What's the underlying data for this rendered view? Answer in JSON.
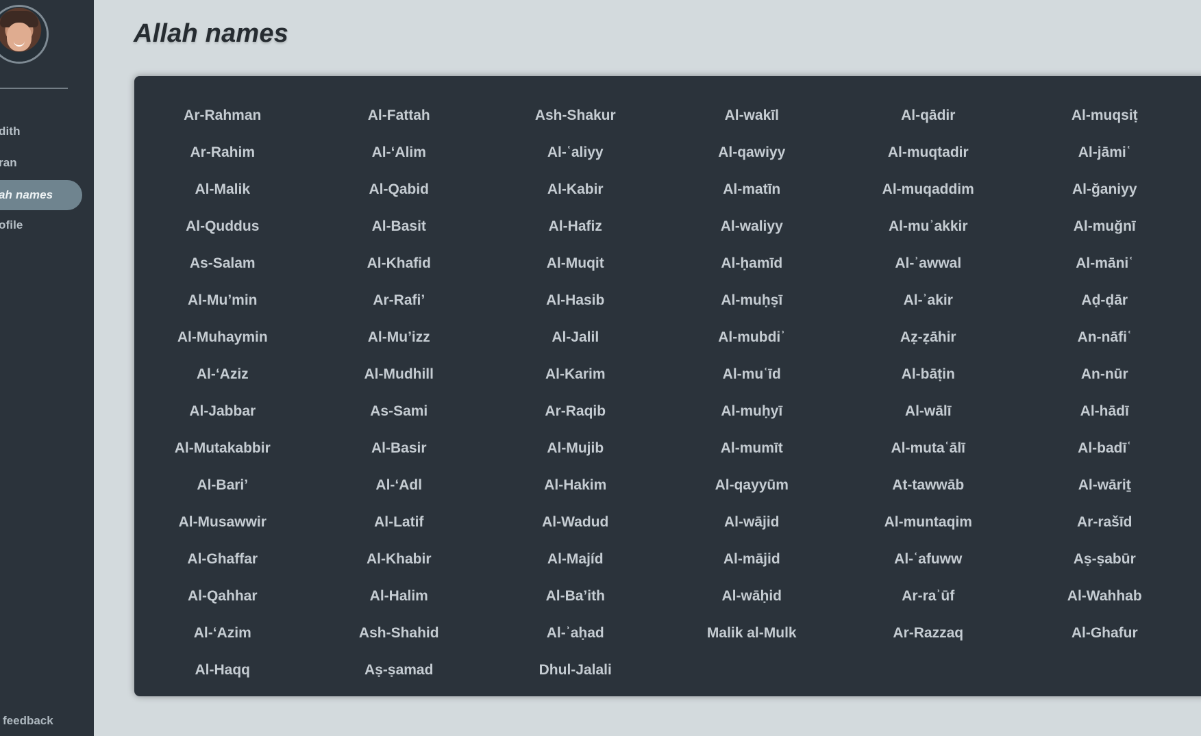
{
  "app": {
    "page_title": "Allah names"
  },
  "sidebar": {
    "avatar": "avatar",
    "items": [
      {
        "label": "dith",
        "active": false
      },
      {
        "label": "ran",
        "active": false
      },
      {
        "label": "ah names",
        "active": true
      },
      {
        "label": "ofile",
        "active": false
      }
    ],
    "feedback_label": "feedback"
  },
  "main": {
    "names": [
      [
        "Ar-Rahman",
        "Al-Fattah",
        "Ash-Shakur",
        "Al-wakīl",
        "Al-qādir",
        "Al-muqsiṭ"
      ],
      [
        "Ar-Rahim",
        "Al-‘Alim",
        "Al-ʿaliyy",
        "Al-qawiyy",
        "Al-muqtadir",
        "Al-jāmiʿ"
      ],
      [
        "Al-Malik",
        "Al-Qabid",
        "Al-Kabir",
        "Al-matīn",
        "Al-muqaddim",
        "Al-ğaniyy"
      ],
      [
        "Al-Quddus",
        "Al-Basit",
        "Al-Hafiz",
        "Al-waliyy",
        "Al-muʾakkir",
        "Al-muğnī"
      ],
      [
        "As-Salam",
        "Al-Khafid",
        "Al-Muqit",
        "Al-ḥamīd",
        "Al-ʾawwal",
        "Al-mā­niʿ"
      ],
      [
        "Al-Mu’min",
        "Ar-Rafi’",
        "Al-Hasib",
        "Al-muḥṣī",
        "Al-ʾakir",
        "Aḍ-ḍār"
      ],
      [
        "Al-Muhaymin",
        "Al-Mu’izz",
        "Al-Jalil",
        "Al-mubdiʾ",
        "Aẓ-ẓāhir",
        "An-nāfiʿ"
      ],
      [
        "Al-‘Aziz",
        "Al-Mudhill",
        "Al-Karim",
        "Al-muʿīd",
        "Al-bāṭin",
        "An-nūr"
      ],
      [
        "Al-Jabbar",
        "As-Sami",
        "Ar-Raqib",
        "Al-muḥyī",
        "Al-wālī",
        "Al-hādī"
      ],
      [
        "Al-Mutakabbir",
        "Al-Basir",
        "Al-Mujib",
        "Al-mumīt",
        "Al-mutaʿālī",
        "Al-badīʿ"
      ],
      [
        "Al-Bari’",
        "Al-‘Adl",
        "Al-Hakim",
        "Al-qayyūm",
        "At-tawwāb",
        "Al-wāriṯ"
      ],
      [
        "Al-Musawwir",
        "Al-Latif",
        "Al-Wadud",
        "Al-wājid",
        "Al-muntaqim",
        "Ar-rašīd"
      ],
      [
        "Al-Ghaffar",
        "Al-Khabir",
        "Al-Majíd",
        "Al-mājid",
        "Al-ʿafuww",
        "Aṣ-ṣabūr"
      ],
      [
        "Al-Qahhar",
        "Al-Halim",
        "Al-Ba’ith",
        "Al-wāḥid",
        "Ar-raʾūf",
        "Al-Wahhab"
      ],
      [
        "Al-‘Azim",
        "Ash-Shahid",
        "Al-ʾaḥad",
        "Malik al-Mulk",
        "Ar-Razzaq",
        "Al-Ghafur"
      ],
      [
        "Al-Haqq",
        "Aṣ-ṣamad",
        "Dhul-Jalali"
      ]
    ]
  }
}
